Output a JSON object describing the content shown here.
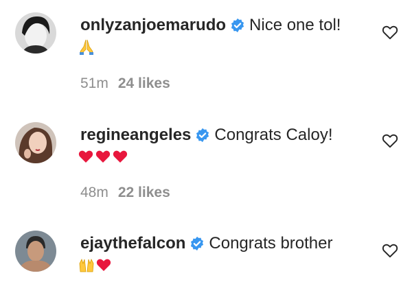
{
  "comments": [
    {
      "username": "onlyzanjoemarudo",
      "text": "Nice one tol!",
      "emoji": "folded-hands",
      "time": "51m",
      "likes": "24 likes"
    },
    {
      "username": "regineangeles",
      "text": "Congrats Caloy!",
      "emoji": "three-red-hearts",
      "time": "48m",
      "likes": "22 likes"
    },
    {
      "username": "ejaythefalcon",
      "text": "Congrats brother",
      "emoji": "raised-hands-and-red-heart",
      "time": "",
      "likes": ""
    }
  ],
  "colors": {
    "text": "#262626",
    "meta": "#8e8e8e",
    "verified": "#3897f0",
    "heart": "#e8173d",
    "emoji_yellow": "#ffc83d"
  }
}
